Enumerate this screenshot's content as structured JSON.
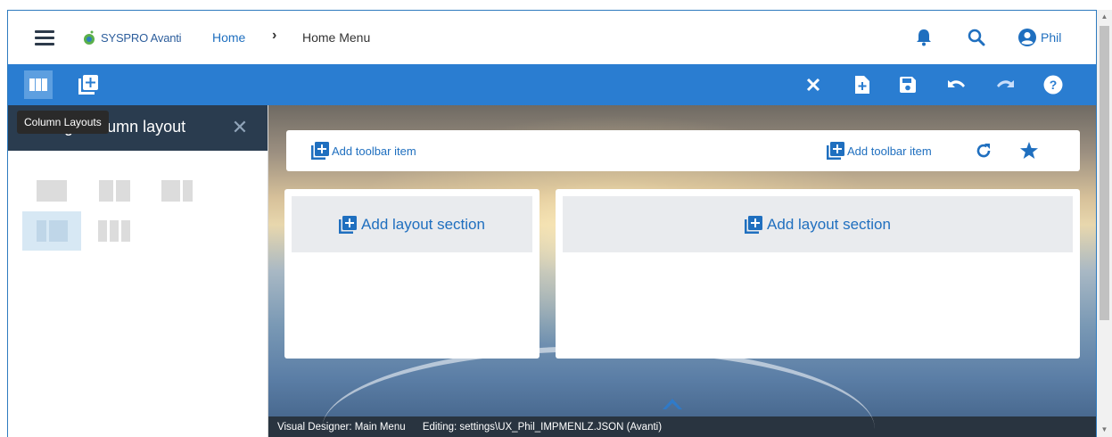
{
  "header": {
    "logo_text": "SYSPRO Avanti",
    "breadcrumb_home": "Home",
    "breadcrumb_separator": "›",
    "breadcrumb_current": "Home Menu",
    "user_name": "Phil"
  },
  "toolbar": {
    "left_icons": [
      "column-layout-icon",
      "add-panel-icon"
    ],
    "right_icons": [
      "close-icon",
      "new-file-icon",
      "save-icon",
      "undo-icon",
      "redo-icon",
      "help-icon"
    ]
  },
  "left_panel": {
    "title": "Change column layout",
    "tooltip": "Column Layouts",
    "layouts": [
      "one-column",
      "two-column",
      "wide-right",
      "wide-left",
      "three-column"
    ],
    "selected_layout": "wide-left"
  },
  "main": {
    "add_toolbar_item": "Add toolbar item",
    "add_layout_section": "Add layout section"
  },
  "status_bar": {
    "designer": "Visual Designer: Main Menu",
    "editing": "Editing: settings\\UX_Phil_IMPMENLZ.JSON  (Avanti)"
  },
  "colors": {
    "toolbar_blue": "#2a7dd1",
    "panel_header": "#2a3c4f",
    "link_blue": "#1f6fbf"
  }
}
